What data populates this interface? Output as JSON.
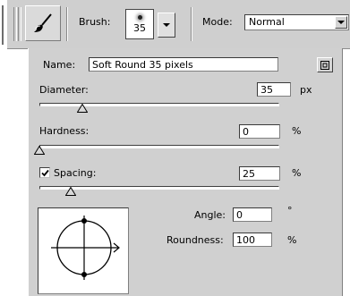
{
  "options_bar": {
    "tool_icon": "brush-tool-icon",
    "brush_label": "Brush:",
    "brush_size": "35",
    "mode_label": "Mode:",
    "mode_value": "Normal"
  },
  "palette": {
    "name_label": "Name:",
    "name_value": "Soft Round 35 pixels",
    "diameter": {
      "label": "Diameter:",
      "value": "35",
      "unit": "px",
      "slider_fraction": 0.18
    },
    "hardness": {
      "label": "Hardness:",
      "value": "0",
      "unit": "%",
      "slider_fraction": 0.0
    },
    "spacing": {
      "label": "Spacing:",
      "checked": true,
      "value": "25",
      "unit": "%",
      "slider_fraction": 0.13
    },
    "angle": {
      "label": "Angle:",
      "value": "0",
      "unit": "°"
    },
    "roundness": {
      "label": "Roundness:",
      "value": "100",
      "unit": "%"
    }
  }
}
